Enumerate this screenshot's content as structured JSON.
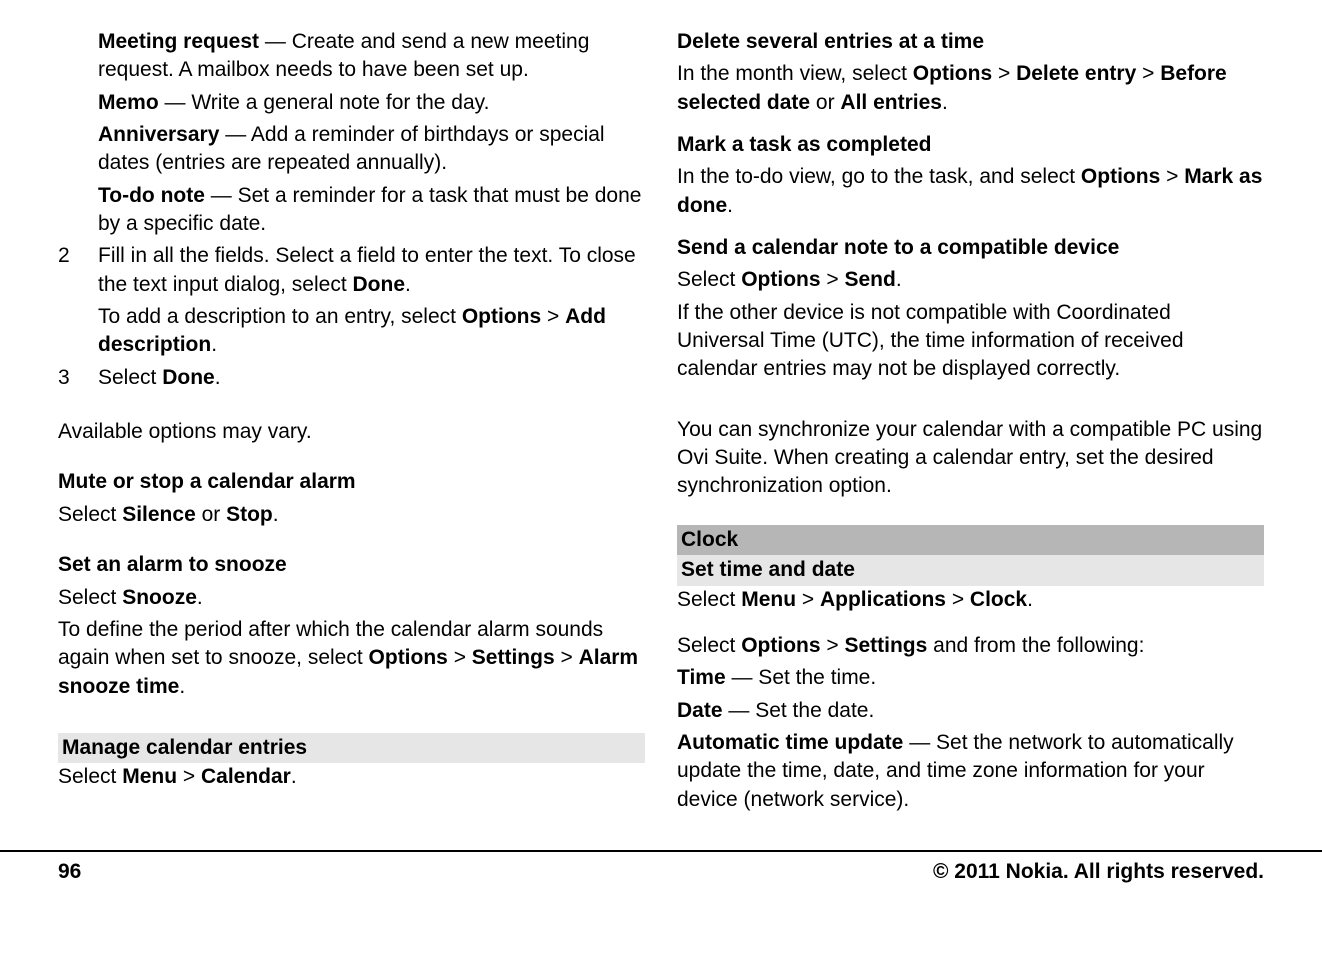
{
  "left": {
    "defs": [
      {
        "term": "Meeting request",
        "desc": " — Create and send a new meeting request. A mailbox needs to have been set up."
      },
      {
        "term": "Memo",
        "desc": " — Write a general note for the day."
      },
      {
        "term": "Anniversary",
        "desc": " — Add a reminder of birthdays or special dates (entries are repeated annually)."
      },
      {
        "term": "To-do note",
        "desc": " — Set a reminder for a task that must be done by a specific date."
      }
    ],
    "step2a": "Fill in all the fields. Select a field to enter the text. To close the text input dialog, select ",
    "step2a_b1": "Done",
    "step2a_end": ".",
    "step2b_pre": "To add a description to an entry, select ",
    "step2b_b1": "Options",
    "step2b_mid": " > ",
    "step2b_b2": "Add description",
    "step2b_end": ".",
    "step3_pre": "Select ",
    "step3_b": "Done",
    "step3_end": ".",
    "avail": "Available options may vary.",
    "h_mute": "Mute or stop a calendar alarm",
    "mute_pre": "Select ",
    "mute_b1": "Silence",
    "mute_mid": " or ",
    "mute_b2": "Stop",
    "mute_end": ".",
    "h_snooze": "Set an alarm to snooze",
    "snooze1_pre": "Select ",
    "snooze1_b": "Snooze",
    "snooze1_end": ".",
    "snooze2_pre": "To define the period after which the calendar alarm sounds again when set to snooze, select ",
    "snooze2_b1": "Options",
    "snooze2_m1": " > ",
    "snooze2_b2": "Settings",
    "snooze2_m2": " > ",
    "snooze2_b3": "Alarm snooze time",
    "snooze2_end": ".",
    "h_manage": "Manage calendar entries",
    "manage_pre": "Select ",
    "manage_b1": "Menu",
    "manage_m1": " > ",
    "manage_b2": "Calendar",
    "manage_end": "."
  },
  "right": {
    "h_del": "Delete several entries at a time",
    "del_pre": "In the month view, select ",
    "del_b1": "Options",
    "del_m1": " > ",
    "del_b2": "Delete entry",
    "del_m2": " > ",
    "del_b3": "Before selected date",
    "del_m3": " or ",
    "del_b4": "All entries",
    "del_end": ".",
    "h_mark": "Mark a task as completed",
    "mark_pre": "In the to-do view, go to the task, and select ",
    "mark_b1": "Options",
    "mark_m1": " > ",
    "mark_b2": "Mark as done",
    "mark_end": ".",
    "h_send": "Send a calendar note to a compatible device",
    "send_pre": "Select ",
    "send_b1": "Options",
    "send_m1": " > ",
    "send_b2": "Send",
    "send_end": ".",
    "send_note": "If the other device is not compatible with Coordinated Universal Time (UTC), the time information of received calendar entries may not be displayed correctly.",
    "sync": "You can synchronize your calendar with a compatible PC using Ovi Suite. When creating a calendar entry, set the desired synchronization option.",
    "h_clock": "Clock",
    "h_settime": "Set time and date",
    "st_pre": "Select ",
    "st_b1": "Menu",
    "st_m1": " > ",
    "st_b2": "Applications",
    "st_m2": " > ",
    "st_b3": "Clock",
    "st_end": ".",
    "opt_pre": "Select ",
    "opt_b1": "Options",
    "opt_m1": " > ",
    "opt_b2": "Settings",
    "opt_end": " and from the following:",
    "defs": [
      {
        "term": "Time",
        "desc": " — Set the time."
      },
      {
        "term": "Date",
        "desc": " — Set the date."
      },
      {
        "term": "Automatic time update",
        "desc": " — Set the network to automatically update the time, date, and time zone information for your device (network service)."
      }
    ]
  },
  "footer": {
    "page": "96",
    "copyright": "© 2011 Nokia. All rights reserved."
  }
}
